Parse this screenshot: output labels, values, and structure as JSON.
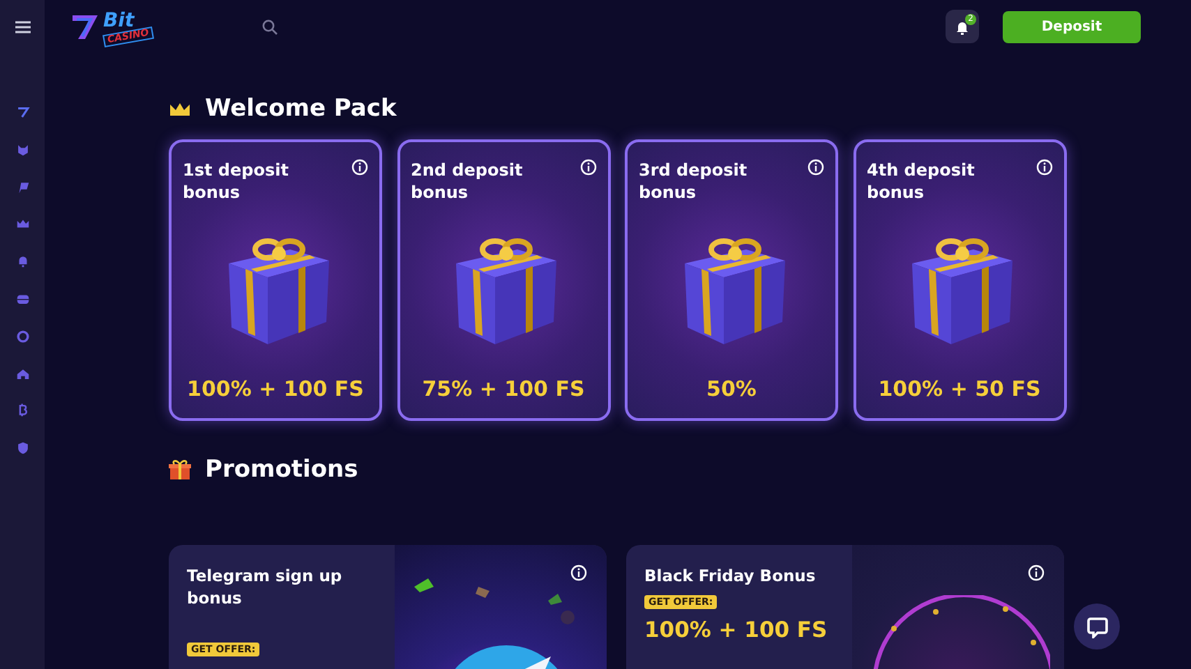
{
  "logo": {
    "word": "Bit",
    "sub": "CASINO"
  },
  "header": {
    "notifications": "2",
    "deposit_button": "Deposit"
  },
  "welcome": {
    "title": "Welcome Pack",
    "cards": [
      {
        "title": "1st deposit bonus",
        "offer": "100% + 100 FS"
      },
      {
        "title": "2nd deposit bonus",
        "offer": "75% + 100 FS"
      },
      {
        "title": "3rd deposit bonus",
        "offer": "50%"
      },
      {
        "title": "4th deposit bonus",
        "offer": "100% + 50 FS"
      }
    ]
  },
  "promotions": {
    "title": "Promotions",
    "cards": [
      {
        "kind": "telegram",
        "title": "Telegram sign up bonus",
        "badge": "GET OFFER:"
      },
      {
        "kind": "gift",
        "title": "Black Friday Bonus",
        "badge": "GET OFFER:",
        "offer": "100% + 100 FS"
      }
    ]
  }
}
